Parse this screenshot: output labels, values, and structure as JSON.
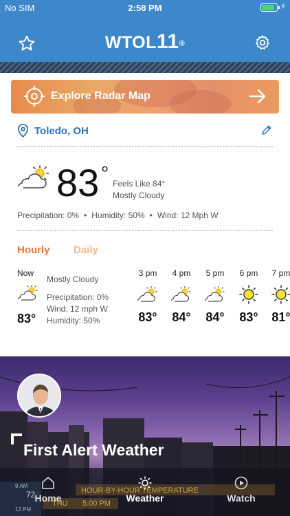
{
  "status": {
    "carrier": "No SIM",
    "time": "2:58 PM"
  },
  "header": {
    "logo_text": "WTOL",
    "logo_num": "11",
    "logo_mark": "®"
  },
  "radar": {
    "label": "Explore Radar Map"
  },
  "location": {
    "name": "Toledo, OH"
  },
  "current": {
    "temp": "83",
    "degree": "°",
    "feels_like": "Feels Like 84°",
    "condition": "Mostly Cloudy",
    "precipitation": "Precipitation: 0%",
    "humidity": "Humidity: 50%",
    "wind": "Wind: 12 Mph W",
    "separator": "•"
  },
  "tabs": {
    "hourly": "Hourly",
    "daily": "Daily"
  },
  "now": {
    "label": "Now",
    "condition": "Mostly Cloudy",
    "precipitation": "Precipitation: 0%",
    "wind": "Wind: 12 mph W",
    "humidity": "Humidity: 50%",
    "temp": "83°"
  },
  "hours": [
    {
      "label": "3 pm",
      "temp": "83°",
      "icon": "partly-cloudy-icon"
    },
    {
      "label": "4 pm",
      "temp": "84°",
      "icon": "partly-cloudy-icon"
    },
    {
      "label": "5 pm",
      "temp": "84°",
      "icon": "partly-cloudy-icon"
    },
    {
      "label": "6 pm",
      "temp": "83°",
      "icon": "sun-icon"
    },
    {
      "label": "7 pm",
      "temp": "81°",
      "icon": "sun-icon"
    }
  ],
  "video": {
    "title": "First Alert Weather"
  },
  "nav": {
    "home": "Home",
    "weather": "Weather",
    "watch": "Watch"
  },
  "ticker": {
    "row1_left": "9 AM",
    "row1_temp": "72",
    "row1_text": "HOUR-BY-HOUR TEMPERATURE",
    "row2_left": "12 PM",
    "row2_day": "THU",
    "row2_time": "5:00 PM"
  },
  "colors": {
    "header": "#3d87cb",
    "accent_orange": "#e27b3d",
    "link_blue": "#2f73b7"
  }
}
